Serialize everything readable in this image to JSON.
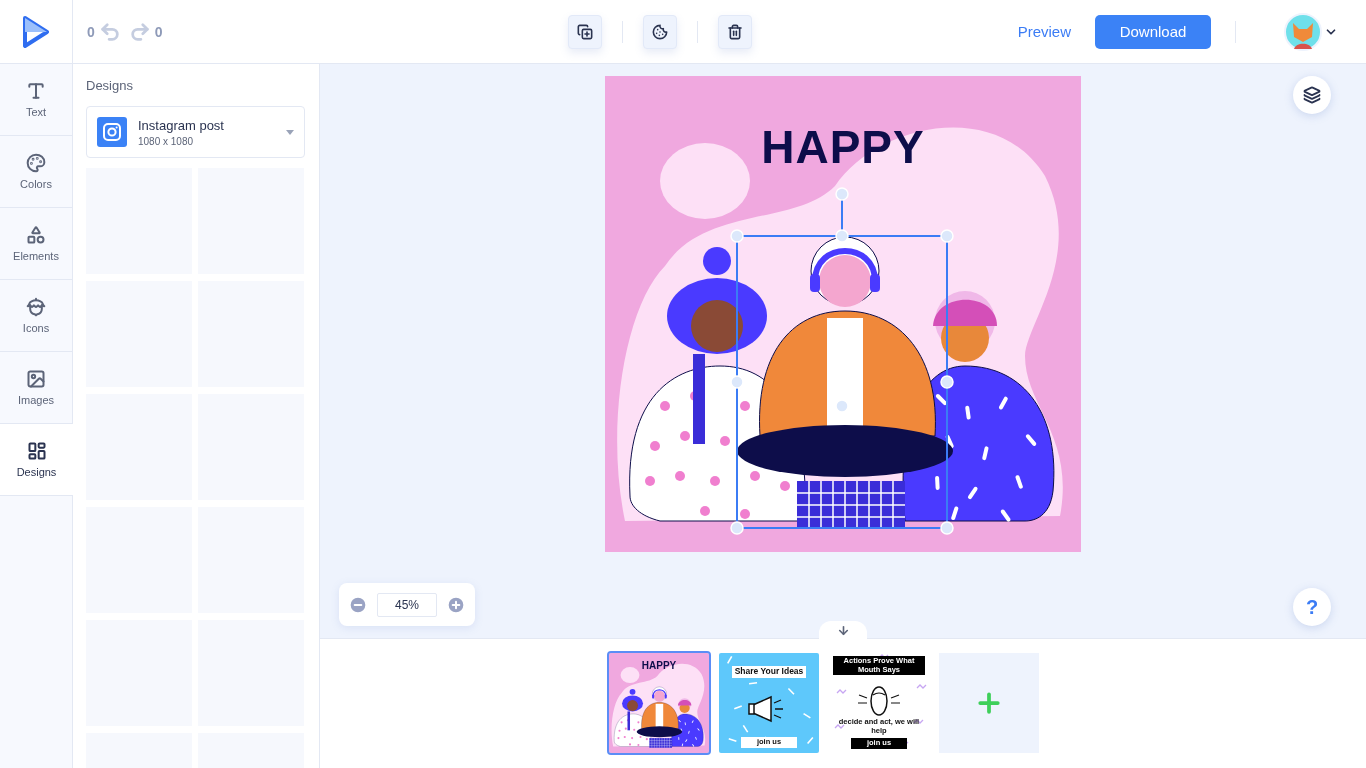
{
  "toolbar": {
    "undo_count": "0",
    "redo_count": "0",
    "actions": [
      {
        "kind": "duplicate"
      },
      {
        "kind": "color"
      },
      {
        "kind": "delete"
      }
    ],
    "preview": "Preview",
    "download": "Download"
  },
  "sidebar": {
    "items": [
      {
        "label": "Text",
        "kind": "text",
        "selected": false
      },
      {
        "label": "Colors",
        "kind": "colors",
        "selected": false
      },
      {
        "label": "Elements",
        "kind": "elements",
        "selected": false
      },
      {
        "label": "Icons",
        "kind": "icons",
        "selected": false
      },
      {
        "label": "Images",
        "kind": "images",
        "selected": false
      },
      {
        "label": "Designs",
        "kind": "designs",
        "selected": true
      }
    ]
  },
  "panel": {
    "title": "Designs",
    "format": {
      "name": "Instagram post",
      "size": "1080 x 1080"
    }
  },
  "canvas": {
    "headline": "HAPPY",
    "zoom": "45%",
    "help": "?"
  },
  "pages": [
    {
      "kind": "happy",
      "title": "HAPPY",
      "selected": true
    },
    {
      "kind": "share",
      "title": "Share Your Ideas",
      "button": "join us",
      "selected": false
    },
    {
      "kind": "actions",
      "title": "Actions Prove What Mouth Says",
      "body": "decide and act, we will help",
      "button": "join us",
      "selected": false
    }
  ]
}
